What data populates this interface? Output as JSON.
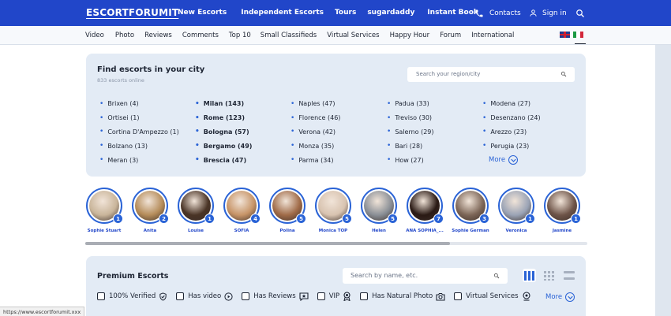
{
  "header": {
    "logo": "ESCORTFORUMIT",
    "nav": [
      "New Escorts",
      "Independent Escorts",
      "Tours",
      "sugardaddy",
      "Instant Book"
    ],
    "contacts": "Contacts",
    "signin": "Sign in"
  },
  "subnav": [
    "Video",
    "Photo",
    "Reviews",
    "Comments",
    "Top 10",
    "Small Classifieds",
    "Virtual Services",
    "Happy Hour",
    "Forum",
    "International"
  ],
  "find": {
    "title": "Find escorts in your city",
    "subtitle": "833 escorts online",
    "search_placeholder": "Search your region/city",
    "columns": [
      [
        {
          "t": "Brixen (4)",
          "b": false
        },
        {
          "t": "Ortisei (1)",
          "b": false
        },
        {
          "t": "Cortina D'Ampezzo (1)",
          "b": false
        },
        {
          "t": "Bolzano (13)",
          "b": false
        },
        {
          "t": "Meran (3)",
          "b": false
        }
      ],
      [
        {
          "t": "Milan (143)",
          "b": true
        },
        {
          "t": "Rome (123)",
          "b": true
        },
        {
          "t": "Bologna (57)",
          "b": true
        },
        {
          "t": "Bergamo (49)",
          "b": true
        },
        {
          "t": "Brescia (47)",
          "b": true
        }
      ],
      [
        {
          "t": "Naples (47)",
          "b": false
        },
        {
          "t": "Florence (46)",
          "b": false
        },
        {
          "t": "Verona (42)",
          "b": false
        },
        {
          "t": "Monza (35)",
          "b": false
        },
        {
          "t": "Parma (34)",
          "b": false
        }
      ],
      [
        {
          "t": "Padua (33)",
          "b": false
        },
        {
          "t": "Treviso (30)",
          "b": false
        },
        {
          "t": "Salerno (29)",
          "b": false
        },
        {
          "t": "Bari (28)",
          "b": false
        },
        {
          "t": "How (27)",
          "b": false
        }
      ],
      [
        {
          "t": "Modena (27)",
          "b": false
        },
        {
          "t": "Desenzano (24)",
          "b": false
        },
        {
          "t": "Arezzo (23)",
          "b": false
        },
        {
          "t": "Perugia (23)",
          "b": false
        }
      ]
    ],
    "more": "More"
  },
  "stories": [
    {
      "name": "Sophie Stuart",
      "count": "1",
      "color": "#c9b59a"
    },
    {
      "name": "Anita",
      "count": "2",
      "color": "#b58c5a"
    },
    {
      "name": "Louise",
      "count": "1",
      "color": "#4a3426"
    },
    {
      "name": "SOFIA",
      "count": "4",
      "color": "#c79467"
    },
    {
      "name": "Polina",
      "count": "5",
      "color": "#a06b48"
    },
    {
      "name": "Monica TOP",
      "count": "5",
      "color": "#d8c3b0"
    },
    {
      "name": "Helen",
      "count": "5",
      "color": "#8a8f96"
    },
    {
      "name": "ANA SOPHIA_...",
      "count": "7",
      "color": "#2a1a14"
    },
    {
      "name": "Sophie German",
      "count": "3",
      "color": "#7d6657"
    },
    {
      "name": "Veronica",
      "count": "1",
      "color": "#9aa3b5"
    },
    {
      "name": "Jasmine",
      "count": "1",
      "color": "#6e5448"
    }
  ],
  "premium": {
    "title": "Premium Escorts",
    "search_placeholder": "Search by name, etc.",
    "filters": [
      "100% Verified",
      "Has video",
      "Has Reviews",
      "VIP",
      "Has Natural Photo",
      "Virtual Services"
    ],
    "more": "More"
  },
  "statusbar": "https://www.escortforumit.xxx",
  "colors": {
    "brand": "#2146c9",
    "accent": "#2a63d6",
    "panel": "#e3ebf5"
  }
}
